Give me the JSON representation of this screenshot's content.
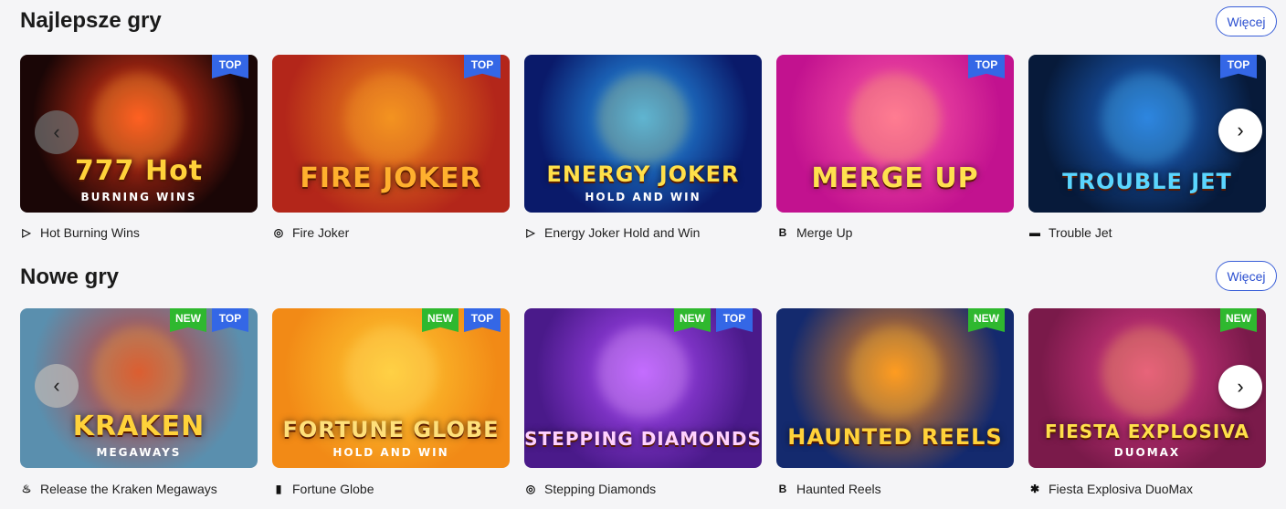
{
  "sections": [
    {
      "title": "Najlepsze gry",
      "more_label": "Więcej",
      "games": [
        {
          "name": "Hot Burning Wins",
          "provider_icon": "play-triangle-icon",
          "art_title": "777 Hot",
          "art_sub": "BURNING WINS",
          "badges": [
            "TOP"
          ],
          "colors": {
            "bg": "#1a0606",
            "accent": "#ff3a1a",
            "text": "#ffd23a"
          }
        },
        {
          "name": "Fire Joker",
          "provider_icon": "play-n-go-icon",
          "art_title": "FIRE JOKER",
          "art_sub": "",
          "badges": [
            "TOP"
          ],
          "colors": {
            "bg": "#b3261a",
            "accent": "#f08a1c",
            "text": "#ffb02e"
          }
        },
        {
          "name": "Energy Joker Hold and Win",
          "provider_icon": "play-triangle-icon",
          "art_title": "ENERGY JOKER",
          "art_sub": "HOLD AND WIN",
          "badges": [],
          "colors": {
            "bg": "#0a1a6a",
            "accent": "#2aa7ff",
            "text": "#ffe04a"
          }
        },
        {
          "name": "Merge Up",
          "provider_icon": "b-square-icon",
          "art_title": "MERGE UP",
          "art_sub": "",
          "badges": [
            "TOP"
          ],
          "colors": {
            "bg": "#c2128f",
            "accent": "#ff5aa8",
            "text": "#ffe14f"
          }
        },
        {
          "name": "Trouble Jet",
          "provider_icon": "dash-icon",
          "art_title": "TROUBLE JET",
          "art_sub": "",
          "badges": [
            "TOP"
          ],
          "colors": {
            "bg": "#071a3a",
            "accent": "#1f6bd6",
            "text": "#5ad6ff"
          }
        }
      ]
    },
    {
      "title": "Nowe gry",
      "more_label": "Więcej",
      "games": [
        {
          "name": "Release the Kraken Megaways",
          "provider_icon": "pragmatic-icon",
          "art_title": "KRAKEN",
          "art_sub": "MEGAWAYS",
          "badges": [
            "NEW",
            "TOP"
          ],
          "colors": {
            "bg": "#5a8fae",
            "accent": "#d0372e",
            "text": "#ffd23a"
          }
        },
        {
          "name": "Fortune Globe",
          "provider_icon": "card-icon",
          "art_title": "FORTUNE GLOBE",
          "art_sub": "HOLD AND WIN",
          "badges": [
            "NEW",
            "TOP"
          ],
          "colors": {
            "bg": "#f28a16",
            "accent": "#ffcc33",
            "text": "#ffe07a"
          }
        },
        {
          "name": "Stepping Diamonds",
          "provider_icon": "play-n-go-icon",
          "art_title": "STEPPING DIAMONDS",
          "art_sub": "",
          "badges": [
            "NEW",
            "TOP"
          ],
          "colors": {
            "bg": "#4a1a8a",
            "accent": "#b04bff",
            "text": "#ffd1ff"
          }
        },
        {
          "name": "Haunted Reels",
          "provider_icon": "b-square-icon",
          "art_title": "HAUNTED REELS",
          "art_sub": "",
          "badges": [
            "NEW"
          ],
          "colors": {
            "bg": "#142a6e",
            "accent": "#ff8a18",
            "text": "#ffd23a"
          }
        },
        {
          "name": "Fiesta Explosiva DuoMax",
          "provider_icon": "tree-icon",
          "art_title": "FIESTA EXPLOSIVA",
          "art_sub": "DUOMAX",
          "badges": [
            "NEW"
          ],
          "colors": {
            "bg": "#7a1a4a",
            "accent": "#e03a8a",
            "text": "#ffe04a"
          }
        }
      ]
    }
  ],
  "arrows": {
    "left": "‹",
    "right": "›"
  }
}
